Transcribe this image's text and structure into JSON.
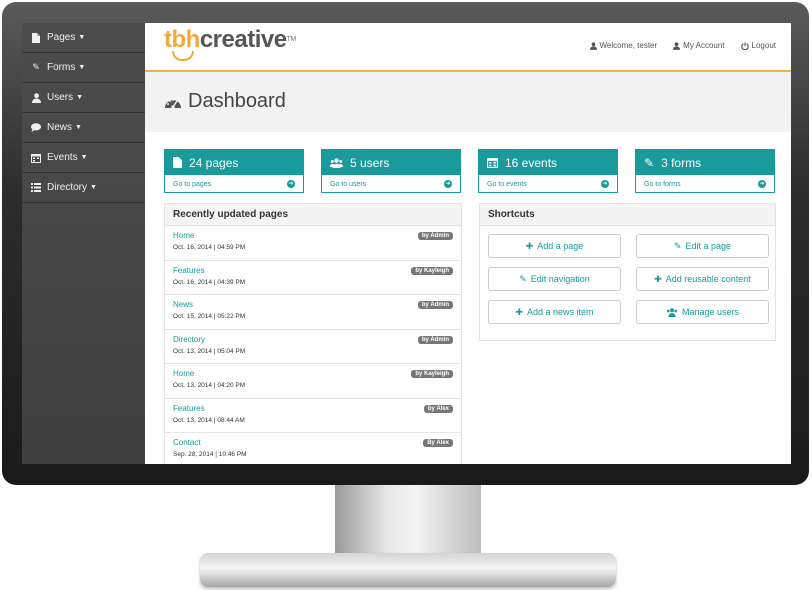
{
  "sidebar": {
    "items": [
      {
        "label": "Pages",
        "icon": "file-icon"
      },
      {
        "label": "Forms",
        "icon": "pencil-icon"
      },
      {
        "label": "Users",
        "icon": "user-icon"
      },
      {
        "label": "News",
        "icon": "comment-icon"
      },
      {
        "label": "Events",
        "icon": "calendar-icon"
      },
      {
        "label": "Directory",
        "icon": "list-icon"
      }
    ]
  },
  "header": {
    "logo_tbh": "tbh",
    "logo_creative": "creative",
    "logo_tm": "TM",
    "welcome": "Welcome, tester",
    "account": "My Account",
    "logout": "Logout"
  },
  "page": {
    "title": "Dashboard"
  },
  "cards": [
    {
      "label": "24 pages",
      "link": "Go to pages",
      "icon": "file-icon"
    },
    {
      "label": "5 users",
      "link": "Go to users",
      "icon": "users-icon"
    },
    {
      "label": "16 events",
      "link": "Go to events",
      "icon": "calendar-icon"
    },
    {
      "label": "3 forms",
      "link": "Go to forms",
      "icon": "pencil-icon"
    }
  ],
  "recent": {
    "title": "Recently updated pages",
    "rows": [
      {
        "name": "Home",
        "date": "Oct. 16, 2014 | 04:59 PM",
        "by": "by Admin"
      },
      {
        "name": "Features",
        "date": "Oct. 16, 2014 | 04:39 PM",
        "by": "by Kayleigh"
      },
      {
        "name": "News",
        "date": "Oct. 15, 2014 | 05:22 PM",
        "by": "by Admin"
      },
      {
        "name": "Directory",
        "date": "Oct. 13, 2014 | 05:04 PM",
        "by": "by Admin"
      },
      {
        "name": "Home",
        "date": "Oct. 13, 2014 | 04:20 PM",
        "by": "by Kayleigh"
      },
      {
        "name": "Features",
        "date": "Oct. 13, 2014 | 08:44 AM",
        "by": "by Alex"
      },
      {
        "name": "Contact",
        "date": "Sep. 28, 2014 | 10:46 PM",
        "by": "By Alex"
      }
    ]
  },
  "shortcuts": {
    "title": "Shortcuts",
    "buttons": [
      {
        "label": "Add a page",
        "icon": "plus-icon"
      },
      {
        "label": "Edit a page",
        "icon": "pencil-icon"
      },
      {
        "label": "Edit navigation",
        "icon": "pencil-icon"
      },
      {
        "label": "Add reusable content",
        "icon": "plus-icon"
      },
      {
        "label": "Add a news item",
        "icon": "plus-icon"
      },
      {
        "label": "Manage users",
        "icon": "users-icon"
      }
    ]
  },
  "colors": {
    "accent": "#1a9a9a",
    "brand_orange": "#f0a93c",
    "sidebar": "#444444"
  }
}
